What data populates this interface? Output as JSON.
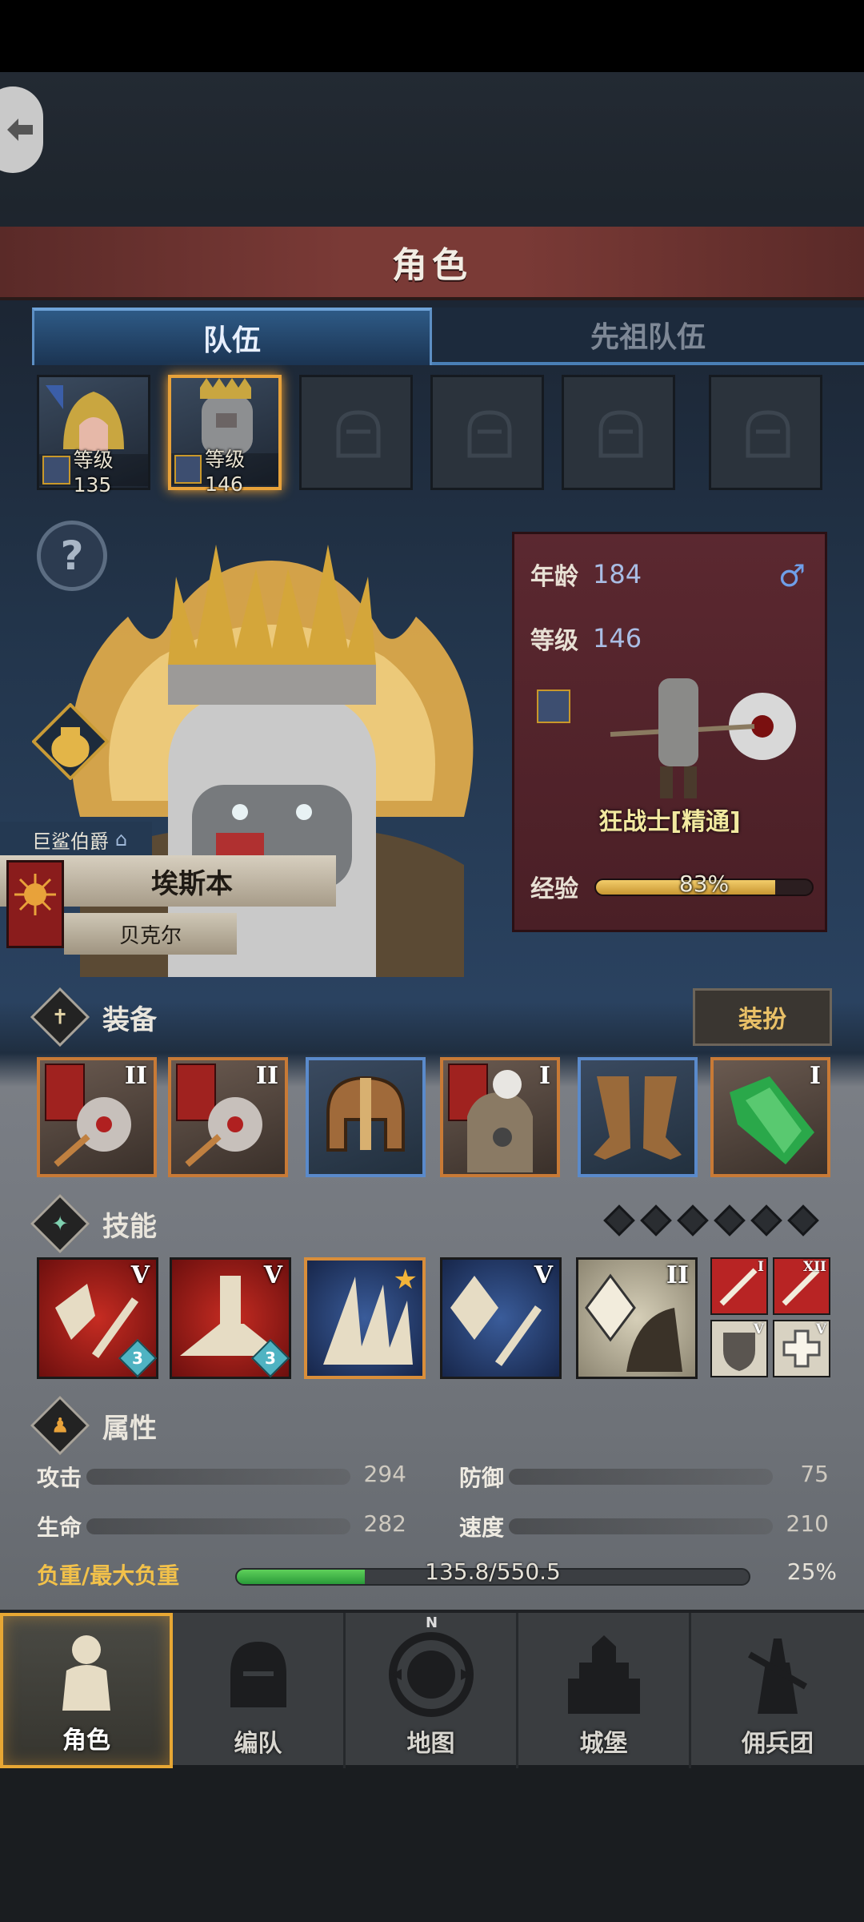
{
  "header": {
    "title": "角色"
  },
  "tabs": [
    {
      "label": "队伍",
      "active": true
    },
    {
      "label": "先祖队伍",
      "active": false
    }
  ],
  "team_slots": [
    {
      "filled": true,
      "selected": false,
      "level_label": "等级135",
      "portrait": "golden-helm-warrior"
    },
    {
      "filled": true,
      "selected": true,
      "level_label": "等级146",
      "portrait": "chainmail-orc-king"
    },
    {
      "filled": false
    },
    {
      "filled": false
    },
    {
      "filled": false
    },
    {
      "filled": false
    }
  ],
  "hero": {
    "rank": "巨鲨伯爵",
    "name": "埃斯本",
    "family": "贝克尔"
  },
  "info_card": {
    "age_label": "年龄",
    "age_value": "184",
    "level_label": "等级",
    "level_value": "146",
    "gender_icon": "male-icon",
    "class_name": "狂战士[精通]",
    "exp_label": "经验",
    "exp_text": "83%",
    "exp_fraction": 0.83
  },
  "equipment": {
    "title": "装备",
    "dress_button": "装扮",
    "items": [
      {
        "name": "flail-weapon",
        "tier": "II",
        "rarity": "orange",
        "flag": true
      },
      {
        "name": "flail-weapon",
        "tier": "II",
        "rarity": "orange",
        "flag": true
      },
      {
        "name": "leather-helmet",
        "tier": "",
        "rarity": "blue",
        "flag": false
      },
      {
        "name": "fur-armor",
        "tier": "I",
        "rarity": "orange",
        "flag": true
      },
      {
        "name": "leather-boots",
        "tier": "",
        "rarity": "blue",
        "flag": false
      },
      {
        "name": "green-crystal-trinket",
        "tier": "I",
        "rarity": "orange",
        "flag": false
      }
    ]
  },
  "skills": {
    "title": "技能",
    "items": [
      {
        "name": "shatter-strike-skill",
        "tier": "V",
        "bg": "red",
        "badge": "3"
      },
      {
        "name": "ground-slam-skill",
        "tier": "V",
        "bg": "red",
        "badge": "3"
      },
      {
        "name": "claw-rend-skill",
        "tier": "",
        "bg": "blue",
        "star": true
      },
      {
        "name": "crystal-sword-skill",
        "tier": "V",
        "bg": "blue"
      },
      {
        "name": "crystal-arm-skill",
        "tier": "II",
        "bg": "pale"
      }
    ],
    "passives": [
      {
        "name": "sword-passive-1",
        "tier": "I"
      },
      {
        "name": "sword-passive-2",
        "tier": "XII"
      },
      {
        "name": "shield-passive",
        "tier": "V"
      },
      {
        "name": "heal-passive",
        "tier": "V"
      }
    ]
  },
  "attributes": {
    "title": "属性",
    "attack_label": "攻击",
    "attack_value": "294",
    "defense_label": "防御",
    "defense_value": "75",
    "hp_label": "生命",
    "hp_value": "282",
    "speed_label": "速度",
    "speed_value": "210",
    "load_label": "负重/最大负重",
    "load_text": "135.8/550.5",
    "load_pct": "25%",
    "load_fraction": 0.25
  },
  "nav": [
    {
      "label": "角色",
      "active": true,
      "icon": "knight-icon"
    },
    {
      "label": "编队",
      "active": false,
      "icon": "helmet-icon"
    },
    {
      "label": "地图",
      "active": false,
      "icon": "compass-map-icon",
      "north": "N"
    },
    {
      "label": "城堡",
      "active": false,
      "icon": "castle-icon"
    },
    {
      "label": "佣兵团",
      "active": false,
      "icon": "mercenary-icon"
    }
  ],
  "colors": {
    "accent_gold": "#e8a23a",
    "exp_gold": "#f2cc6a",
    "load_green": "#3fb84a",
    "class_blue": "#a9bde4"
  }
}
